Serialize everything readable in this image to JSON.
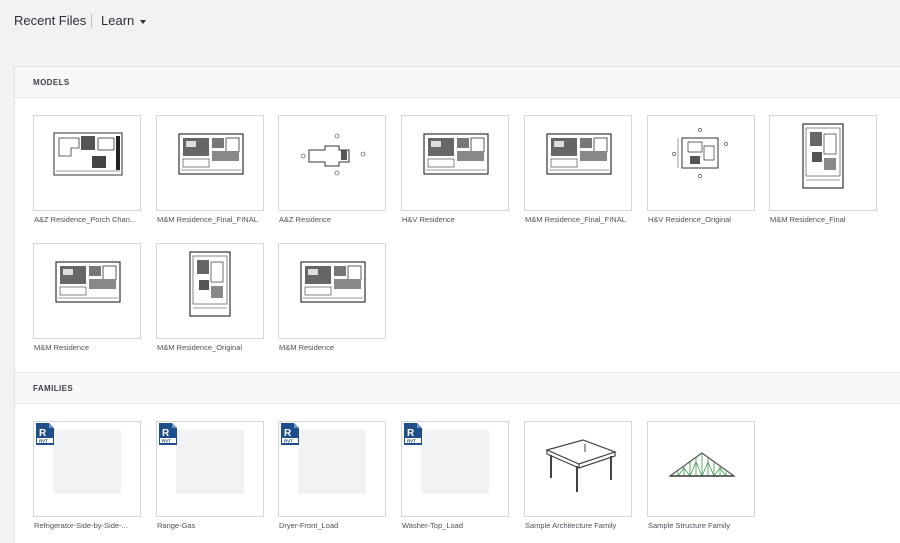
{
  "topbar": {
    "recent_label": "Recent Files",
    "learn_label": "Learn"
  },
  "models": {
    "header": "MODELS",
    "items": [
      {
        "name": "A&Z Residence_Porch Chan..."
      },
      {
        "name": "M&M Residence_Final_FINAL"
      },
      {
        "name": "A&Z Residence"
      },
      {
        "name": "H&V Residence"
      },
      {
        "name": "M&M Residence_Final_FINAL"
      },
      {
        "name": "H&V Residence_Original"
      },
      {
        "name": "M&M Residence_Final"
      },
      {
        "name": "M&M Residence"
      },
      {
        "name": "M&M Residence_Original"
      },
      {
        "name": "M&M Residence"
      }
    ]
  },
  "families": {
    "header": "FAMILIES",
    "items": [
      {
        "name": "Refrigerator-Side-by-Side-..."
      },
      {
        "name": "Range-Gas"
      },
      {
        "name": "Dryer-Front_Load"
      },
      {
        "name": "Washer-Top_Load"
      },
      {
        "name": "Sample Architecture Family"
      },
      {
        "name": "Sample Structure Family"
      }
    ]
  },
  "icons": {
    "rvt": "rvt-file-icon",
    "learn_caret": "chevron-down-icon"
  },
  "colors": {
    "rvt_blue": "#1f4e8c",
    "truss_green": "#3a9a4a"
  }
}
